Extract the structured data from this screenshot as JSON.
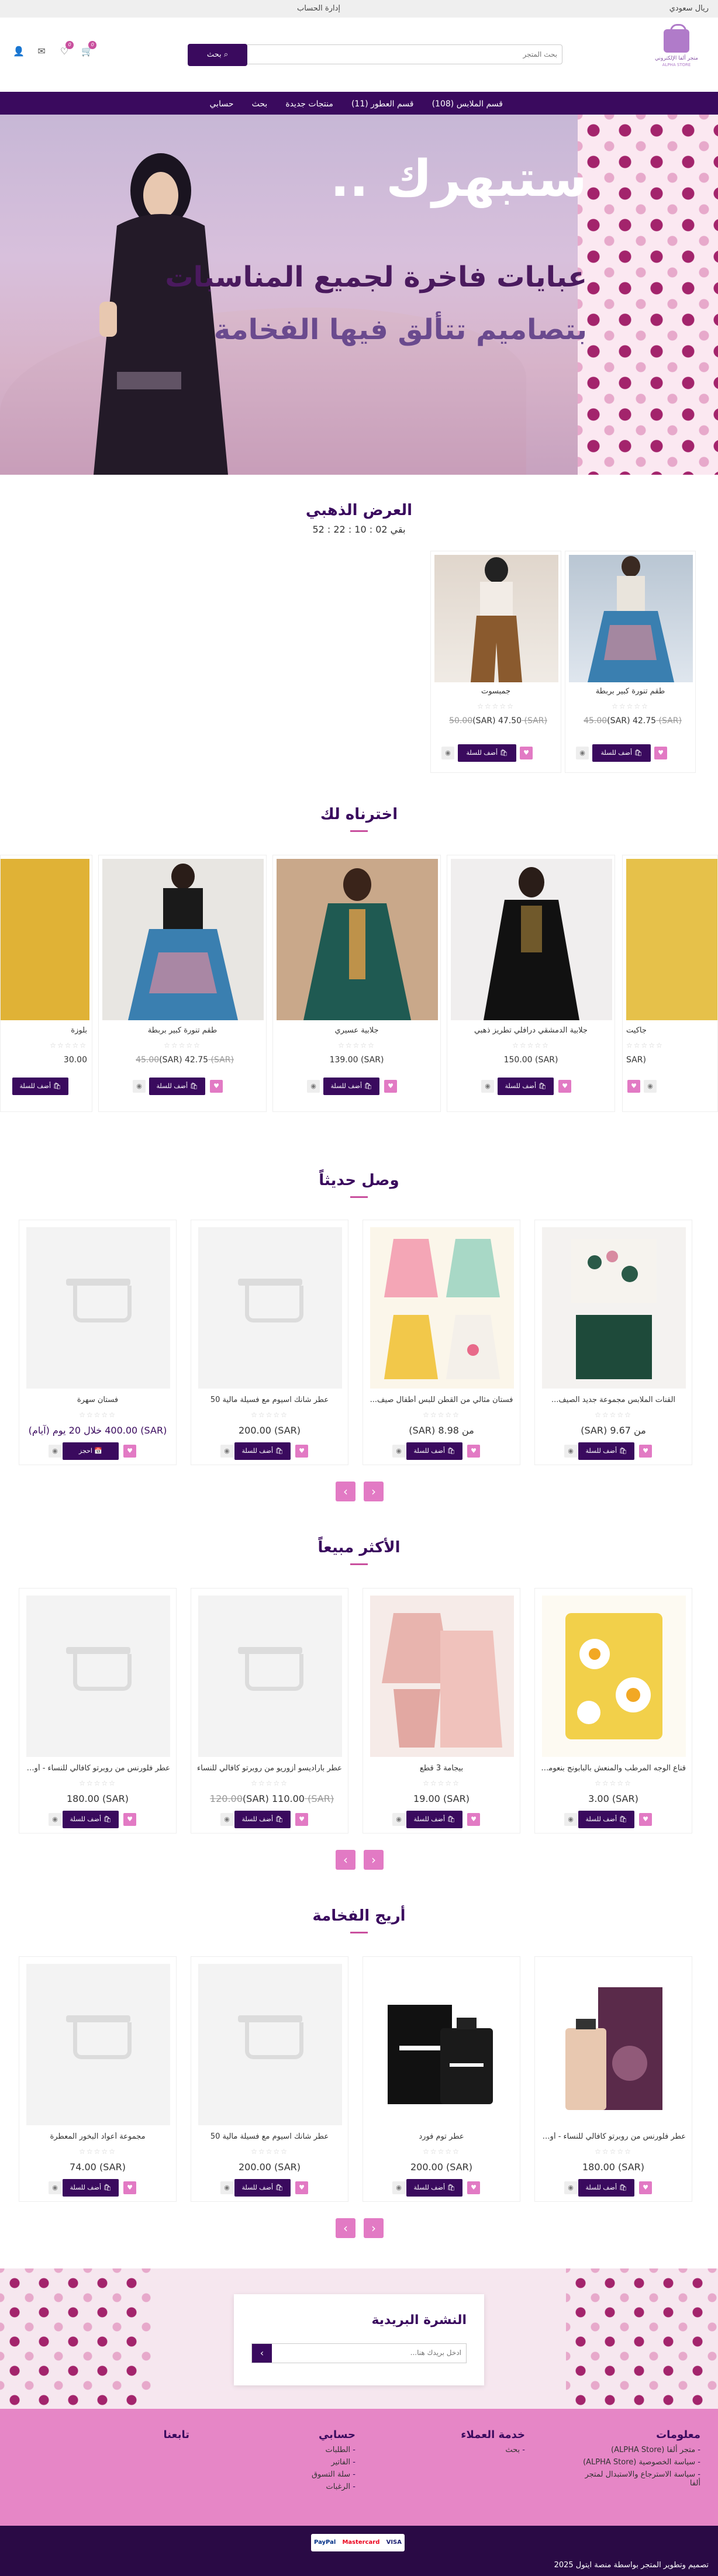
{
  "topbar": {
    "currency": "ريال سعودي",
    "account": "إدارة الحساب"
  },
  "logo": {
    "line1": "متجر ألفا الإلكتروني",
    "line2": "ALPHA STORE"
  },
  "search": {
    "placeholder": "بحث المتجر",
    "button": "بحث"
  },
  "header_icons": [
    {
      "icon": "user-icon"
    },
    {
      "icon": "mail-icon"
    },
    {
      "icon": "heart-icon",
      "badge": "0"
    },
    {
      "icon": "cart-icon",
      "badge": "0"
    }
  ],
  "nav": {
    "items": [
      "قسم الملابس (108)",
      "قسم العطور (11)",
      "منتجات جديدة",
      "بحث",
      "حسابي"
    ]
  },
  "hero": {
    "headline": "ستبهرك ..",
    "line2": "عبايات فاخرة لجميع المناسبات",
    "line3": "بتصاميم تتألق فيها الفخامة"
  },
  "golden_offer": {
    "title": "العرض الذهبي",
    "countdown": "بقي 02 : 10 : 22 : 52",
    "add_label": "أضف للسلة",
    "products": [
      {
        "name": "طقم تنورة كبير بربطة",
        "old_price": "(SAR) 45.00",
        "price": "(SAR) 42.75"
      },
      {
        "name": "جمبسوت",
        "old_price": "(SAR) 50.00",
        "price": "(SAR) 47.50"
      }
    ]
  },
  "picks": {
    "title": "اخترناه لك",
    "add_label": "أضف للسلة",
    "products": [
      {
        "name": "جاكيت",
        "old_price": "",
        "price": "(SAR"
      },
      {
        "name": "جلابية الدمشقي درافلي تطريز ذهبي",
        "old_price": "",
        "price": "(SAR) 150.00"
      },
      {
        "name": "جلابية عسيري",
        "old_price": "",
        "price": "(SAR) 139.00"
      },
      {
        "name": "طقم تنورة كبير بربطة",
        "old_price": "(SAR) 45.00",
        "price": "(SAR) 42.75"
      },
      {
        "name": "بلوزة",
        "old_price": "",
        "price": "30.00"
      }
    ]
  },
  "new_arrivals": {
    "title": "وصل حديثاً",
    "add_label": "أضف للسلة",
    "products": [
      {
        "name": "القنات الملابس مجموعة جديد الصيف...",
        "price": "من 9.67 (SAR)",
        "button": "أضف للسلة"
      },
      {
        "name": "فستان مثالي من القطن للبس أطفال صيف...",
        "price": "من 8.98 (SAR)",
        "button": "أضف للسلة"
      },
      {
        "name": "عطر شانك اسيوم مع فسيلة مالية 50",
        "price": "(SAR) 200.00",
        "button": "أضف للسلة"
      },
      {
        "name": "فستان سهرة",
        "price": "(SAR) 400.00 خلال 20 يوم (آيام)",
        "button": "احجز"
      }
    ]
  },
  "best_sellers": {
    "title": "الأكثر مبيعاً",
    "add_label": "أضف للسلة",
    "products": [
      {
        "name": "قناع الوجه المرطب والمنعش بالبابونج بنعومة...",
        "old_price": "",
        "price": "(SAR) 3.00"
      },
      {
        "name": "بيجامة 3 قطع",
        "old_price": "",
        "price": "(SAR) 19.00"
      },
      {
        "name": "عطر باراديسو أزوريو من روبرتو كافالي للنساء",
        "old_price": "(SAR) 120.00",
        "price": "(SAR) 110.00"
      },
      {
        "name": "عطر فلورنس من روبرتو كافالي للنساء - أو دي...",
        "old_price": "",
        "price": "(SAR) 180.00"
      }
    ]
  },
  "luxury_scents": {
    "title": "أريج الفخامة",
    "add_label": "أضف للسلة",
    "products": [
      {
        "name": "عطر فلورنس من روبرتو كافالي للنساء - أو دي...",
        "price": "(SAR) 180.00"
      },
      {
        "name": "عطر توم فورد",
        "price": "(SAR) 200.00"
      },
      {
        "name": "عطر شانك اسيوم مع فسيلة مالية 50",
        "price": "(SAR) 200.00"
      },
      {
        "name": "مجموعة أعواد البخور المعطرة",
        "price": "(SAR) 74.00"
      }
    ]
  },
  "newsletter": {
    "title": "النشرة البريدية",
    "placeholder": "ادخل بريدك هنا..."
  },
  "footer": {
    "info": {
      "title": "معلومات",
      "links": [
        "متجر ألفا (ALPHA Store)",
        "سياسة الخصوصية (ALPHA Store)",
        "سياسة الاسترجاع والاستبدال لمتجر ألفا"
      ]
    },
    "service": {
      "title": "خدمة العملاء",
      "links": [
        "بحث"
      ]
    },
    "account": {
      "title": "حسابي",
      "links": [
        "الطلبات",
        "الفاتير",
        "سلة التسوق",
        "الرغبات"
      ]
    },
    "follow": {
      "title": "تابعنا"
    }
  },
  "payments": [
    "VISA",
    "Mastercard",
    "PayPal"
  ],
  "copyright": "تصميم وتطوير المتجر بواسطة منصة ايتول 2025"
}
